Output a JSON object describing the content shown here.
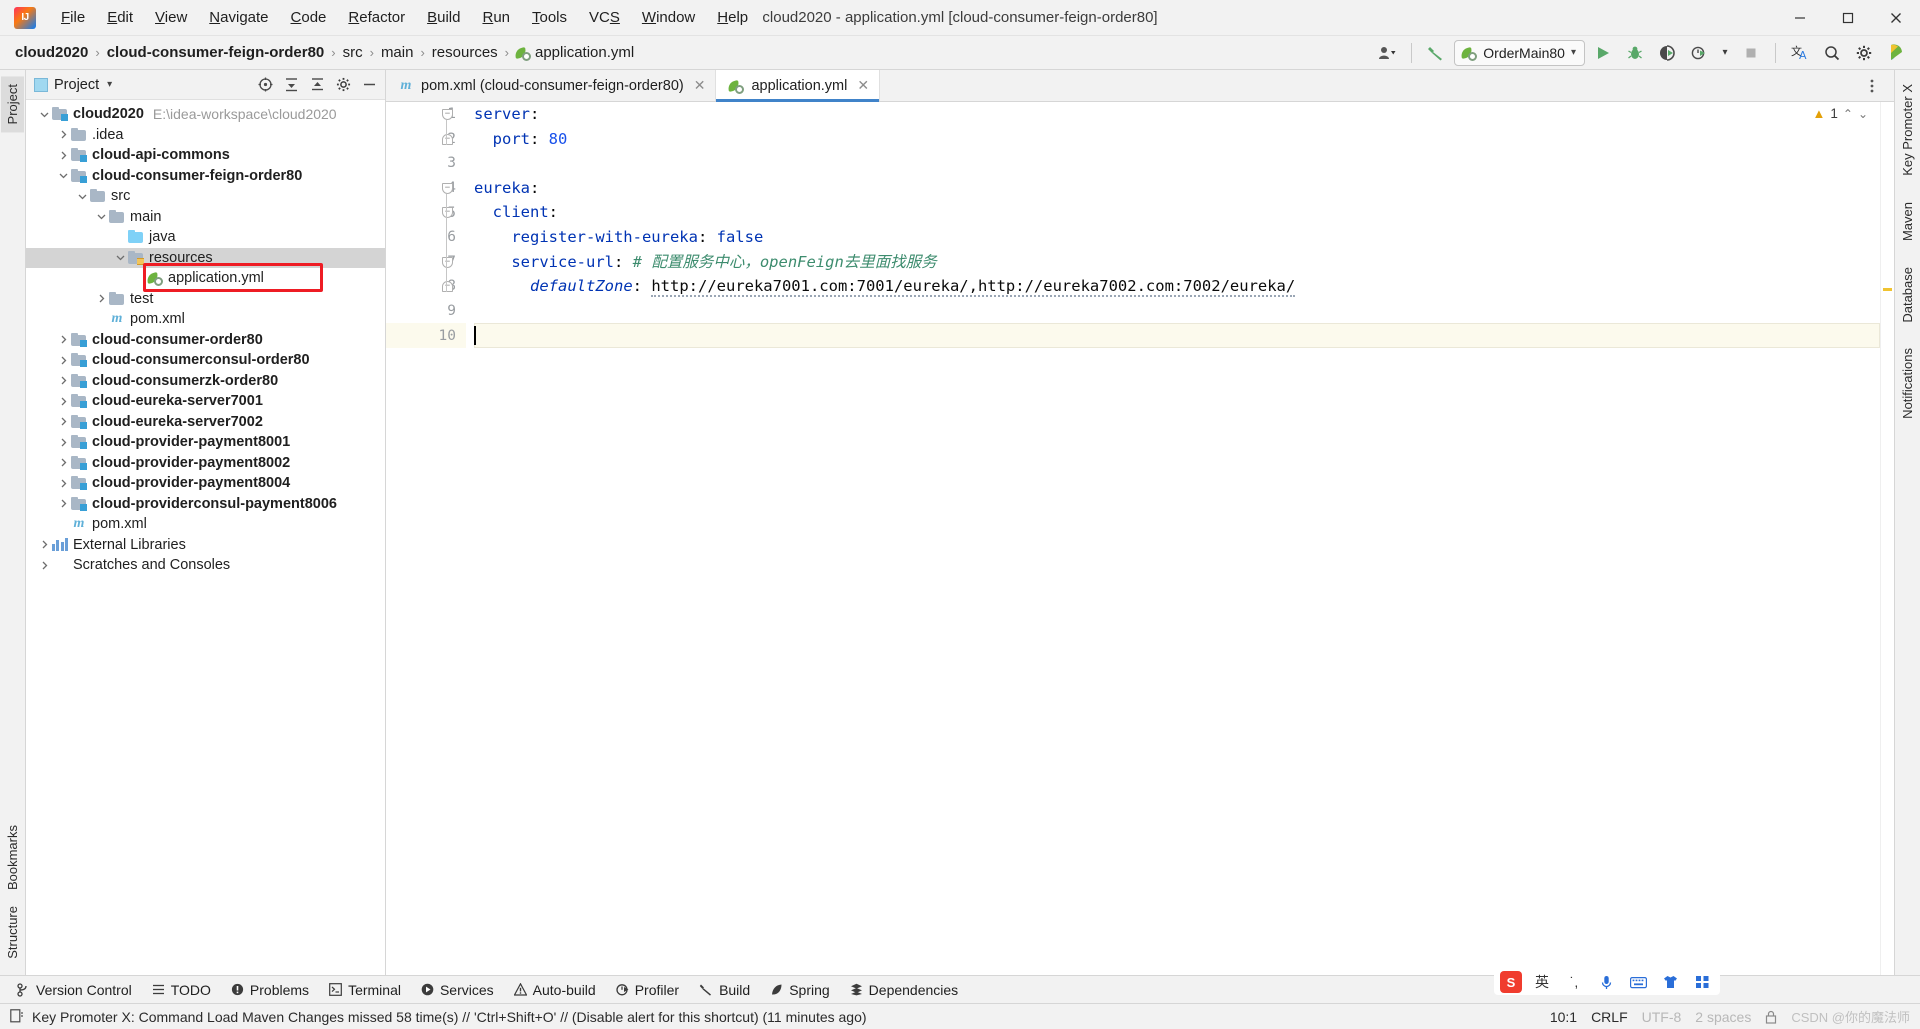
{
  "window": {
    "title": "cloud2020 - application.yml [cloud-consumer-feign-order80]",
    "minimize": "─",
    "maximize": "☐",
    "close": "✕",
    "logo_text": "IJ"
  },
  "menubar": {
    "items": [
      {
        "label": "File"
      },
      {
        "label": "Edit"
      },
      {
        "label": "View"
      },
      {
        "label": "Navigate"
      },
      {
        "label": "Code"
      },
      {
        "label": "Refactor"
      },
      {
        "label": "Build"
      },
      {
        "label": "Run"
      },
      {
        "label": "Tools"
      },
      {
        "label": "VCS"
      },
      {
        "label": "Window"
      },
      {
        "label": "Help"
      }
    ]
  },
  "navbar": {
    "breadcrumbs": [
      {
        "label": "cloud2020",
        "bold": true
      },
      {
        "label": "cloud-consumer-feign-order80",
        "bold": true
      },
      {
        "label": "src",
        "bold": false
      },
      {
        "label": "main",
        "bold": false
      },
      {
        "label": "resources",
        "bold": false
      },
      {
        "label": "application.yml",
        "bold": false
      }
    ],
    "separator": "›",
    "run_configuration": "OrderMain80",
    "dropdown_arrow": "▾",
    "icons": {
      "user": "user-icon",
      "build": "hammer-icon",
      "run": "run-icon",
      "debug": "debug-icon",
      "coverage": "coverage-icon",
      "profile": "profile-icon",
      "stop": "stop-icon",
      "translate": "translate-icon",
      "search": "search-icon",
      "settings": "gear-icon",
      "updates": "updates-icon"
    }
  },
  "left_strip": {
    "top_tabs": [
      {
        "label": "Project",
        "active": true
      }
    ],
    "bottom_tabs": [
      {
        "label": "Bookmarks"
      },
      {
        "label": "Structure"
      }
    ]
  },
  "right_strip": {
    "tabs": [
      {
        "label": "Key Promoter X"
      },
      {
        "label": "Maven"
      },
      {
        "label": "Database"
      },
      {
        "label": "Notifications"
      }
    ]
  },
  "project_panel": {
    "title": "Project",
    "title_arrow": "▾",
    "header_icons": [
      "target-icon",
      "expand-all-icon",
      "collapse-all-icon",
      "gear-icon",
      "hide-icon"
    ],
    "tree": [
      {
        "depth": 0,
        "chev": "⌄",
        "icon": "module",
        "label": "cloud2020",
        "bold": true,
        "path": "E:\\idea-workspace\\cloud2020"
      },
      {
        "depth": 1,
        "chev": "›",
        "icon": "folder",
        "label": ".idea",
        "bold": false,
        "path": ""
      },
      {
        "depth": 1,
        "chev": "›",
        "icon": "module",
        "label": "cloud-api-commons",
        "bold": true,
        "path": ""
      },
      {
        "depth": 1,
        "chev": "⌄",
        "icon": "module",
        "label": "cloud-consumer-feign-order80",
        "bold": true,
        "path": ""
      },
      {
        "depth": 2,
        "chev": "⌄",
        "icon": "folder",
        "label": "src",
        "bold": false,
        "path": ""
      },
      {
        "depth": 3,
        "chev": "⌄",
        "icon": "folder",
        "label": "main",
        "bold": false,
        "path": ""
      },
      {
        "depth": 4,
        "chev": "",
        "icon": "src",
        "label": "java",
        "bold": false,
        "path": ""
      },
      {
        "depth": 4,
        "chev": "⌄",
        "icon": "res",
        "label": "resources",
        "bold": false,
        "path": "",
        "selected": true
      },
      {
        "depth": 5,
        "chev": "",
        "icon": "spring",
        "label": "application.yml",
        "bold": false,
        "path": "",
        "annotated": true
      },
      {
        "depth": 3,
        "chev": "›",
        "icon": "folder",
        "label": "test",
        "bold": false,
        "path": ""
      },
      {
        "depth": 3,
        "chev": "",
        "icon": "maven",
        "label": "pom.xml",
        "bold": false,
        "path": ""
      },
      {
        "depth": 1,
        "chev": "›",
        "icon": "module",
        "label": "cloud-consumer-order80",
        "bold": true,
        "path": ""
      },
      {
        "depth": 1,
        "chev": "›",
        "icon": "module",
        "label": "cloud-consumerconsul-order80",
        "bold": true,
        "path": ""
      },
      {
        "depth": 1,
        "chev": "›",
        "icon": "module",
        "label": "cloud-consumerzk-order80",
        "bold": true,
        "path": ""
      },
      {
        "depth": 1,
        "chev": "›",
        "icon": "module",
        "label": "cloud-eureka-server7001",
        "bold": true,
        "path": ""
      },
      {
        "depth": 1,
        "chev": "›",
        "icon": "module",
        "label": "cloud-eureka-server7002",
        "bold": true,
        "path": ""
      },
      {
        "depth": 1,
        "chev": "›",
        "icon": "module",
        "label": "cloud-provider-payment8001",
        "bold": true,
        "path": ""
      },
      {
        "depth": 1,
        "chev": "›",
        "icon": "module",
        "label": "cloud-provider-payment8002",
        "bold": true,
        "path": ""
      },
      {
        "depth": 1,
        "chev": "›",
        "icon": "module",
        "label": "cloud-provider-payment8004",
        "bold": true,
        "path": ""
      },
      {
        "depth": 1,
        "chev": "›",
        "icon": "module",
        "label": "cloud-providerconsul-payment8006",
        "bold": true,
        "path": ""
      },
      {
        "depth": 1,
        "chev": "",
        "icon": "maven",
        "label": "pom.xml",
        "bold": false,
        "path": ""
      },
      {
        "depth": 0,
        "chev": "›",
        "icon": "lib",
        "label": "External Libraries",
        "bold": false,
        "path": ""
      },
      {
        "depth": 0,
        "chev": "›",
        "icon": "scratch",
        "label": "Scratches and Consoles",
        "bold": false,
        "path": ""
      }
    ]
  },
  "editor": {
    "tabs": [
      {
        "label": "pom.xml (cloud-consumer-feign-order80)",
        "icon": "maven-icon",
        "active": false,
        "close": "✕"
      },
      {
        "label": "application.yml",
        "icon": "spring-icon",
        "active": true,
        "close": "✕"
      }
    ],
    "inspection": {
      "count": "1",
      "icon": "warning-triangle-icon",
      "chevron_up": "⌃",
      "chevron_down": "⌄"
    },
    "lines": [
      {
        "no": "1",
        "tokens": [
          {
            "t": "server",
            "c": "key"
          },
          {
            "t": ":",
            "c": "plain"
          }
        ],
        "fold": "open"
      },
      {
        "no": "2",
        "tokens": [
          {
            "t": "  ",
            "c": "plain"
          },
          {
            "t": "port",
            "c": "key"
          },
          {
            "t": ": ",
            "c": "plain"
          },
          {
            "t": "80",
            "c": "num"
          }
        ],
        "fold": "end"
      },
      {
        "no": "3",
        "tokens": [],
        "fold": ""
      },
      {
        "no": "4",
        "tokens": [
          {
            "t": "eureka",
            "c": "key"
          },
          {
            "t": ":",
            "c": "plain"
          }
        ],
        "fold": "open"
      },
      {
        "no": "5",
        "tokens": [
          {
            "t": "  ",
            "c": "plain"
          },
          {
            "t": "client",
            "c": "key"
          },
          {
            "t": ":",
            "c": "plain"
          }
        ],
        "fold": "open"
      },
      {
        "no": "6",
        "tokens": [
          {
            "t": "    ",
            "c": "plain"
          },
          {
            "t": "register-with-eureka",
            "c": "key"
          },
          {
            "t": ": ",
            "c": "plain"
          },
          {
            "t": "false",
            "c": "bool"
          }
        ],
        "fold": ""
      },
      {
        "no": "7",
        "tokens": [
          {
            "t": "    ",
            "c": "plain"
          },
          {
            "t": "service-url",
            "c": "key"
          },
          {
            "t": ": ",
            "c": "plain"
          },
          {
            "t": "# 配置服务中心，openFeign去里面找服务",
            "c": "comment"
          }
        ],
        "fold": "open"
      },
      {
        "no": "8",
        "tokens": [
          {
            "t": "      ",
            "c": "plain"
          },
          {
            "t": "defaultZone",
            "c": "anchor"
          },
          {
            "t": ": ",
            "c": "plain"
          },
          {
            "t": "http://eureka7001.com:7001/eureka/,http://eureka7002.com:7002/eureka/",
            "c": "str"
          }
        ],
        "fold": "end"
      },
      {
        "no": "9",
        "tokens": [],
        "fold": ""
      },
      {
        "no": "10",
        "tokens": [],
        "fold": "",
        "current": true
      }
    ]
  },
  "tool_windows": {
    "items": [
      {
        "label": "Version Control",
        "icon": "branch-icon"
      },
      {
        "label": "TODO",
        "icon": "list-icon"
      },
      {
        "label": "Problems",
        "icon": "error-icon"
      },
      {
        "label": "Terminal",
        "icon": "terminal-icon"
      },
      {
        "label": "Services",
        "icon": "services-icon"
      },
      {
        "label": "Auto-build",
        "icon": "warning-icon"
      },
      {
        "label": "Profiler",
        "icon": "profiler-icon"
      },
      {
        "label": "Build",
        "icon": "hammer-icon"
      },
      {
        "label": "Spring",
        "icon": "spring-leaf-icon"
      },
      {
        "label": "Dependencies",
        "icon": "dependencies-icon"
      }
    ]
  },
  "statusbar": {
    "message": "Key Promoter X: Command Load Maven Changes missed 58 time(s) // 'Ctrl+Shift+O' // (Disable alert for this shortcut) (11 minutes ago)",
    "message_icon": "notification-icon",
    "caret_position": "10:1",
    "line_separator": "CRLF",
    "encoding": "UTF-8",
    "indent": "2 spaces",
    "lock_icon": "lock-icon",
    "watermark": "CSDN @你的魔法师",
    "ime": {
      "badge": "S",
      "lang": "英",
      "punct": "˙,",
      "mic": "mic-icon",
      "keyboard": "keyboard-icon",
      "shirt": "skin-icon",
      "apps": "apps-icon"
    }
  }
}
